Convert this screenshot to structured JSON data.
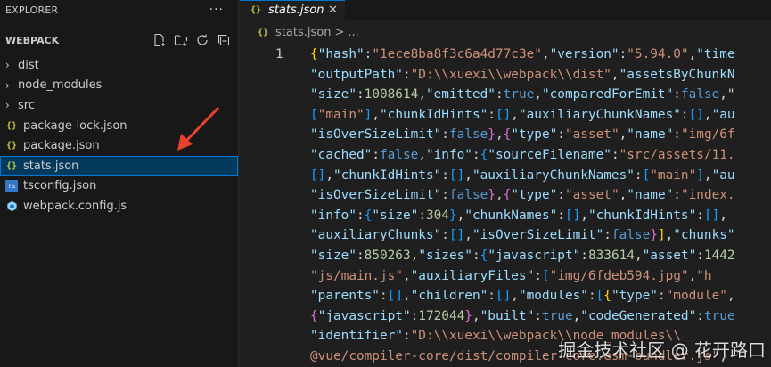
{
  "explorer": {
    "header": "EXPLORER",
    "more": "···",
    "section_title": "WEBPACK",
    "items": [
      {
        "label": "dist",
        "type": "folder"
      },
      {
        "label": "node_modules",
        "type": "folder"
      },
      {
        "label": "src",
        "type": "folder"
      },
      {
        "label": "package-lock.json",
        "type": "json"
      },
      {
        "label": "package.json",
        "type": "json"
      },
      {
        "label": "stats.json",
        "type": "json",
        "selected": true
      },
      {
        "label": "tsconfig.json",
        "type": "ts"
      },
      {
        "label": "webpack.config.js",
        "type": "webpack"
      }
    ]
  },
  "editor": {
    "tab_label": "stats.json",
    "breadcrumb": {
      "file": "stats.json",
      "separator": ">",
      "more": "..."
    },
    "line_number": "1",
    "code_lines": [
      [
        [
          "{",
          "b1"
        ],
        [
          "\"hash\"",
          "key"
        ],
        [
          ":",
          "p"
        ],
        [
          "\"1ece8ba8f3c6a4d77c3e\"",
          "str"
        ],
        [
          ",",
          "p"
        ],
        [
          "\"version\"",
          "key"
        ],
        [
          ":",
          "p"
        ],
        [
          "\"5.94.0\"",
          "str"
        ],
        [
          ",",
          "p"
        ],
        [
          "\"time",
          "key"
        ]
      ],
      [
        [
          "\"outputPath\"",
          "key"
        ],
        [
          ":",
          "p"
        ],
        [
          "\"D:\\\\xuexi\\\\webpack\\\\dist\"",
          "str"
        ],
        [
          ",",
          "p"
        ],
        [
          "\"assetsByChunkN",
          "key"
        ]
      ],
      [
        [
          "\"size\"",
          "key"
        ],
        [
          ":",
          "p"
        ],
        [
          "1008614",
          "num"
        ],
        [
          ",",
          "p"
        ],
        [
          "\"emitted\"",
          "key"
        ],
        [
          ":",
          "p"
        ],
        [
          "true",
          "kw"
        ],
        [
          ",",
          "p"
        ],
        [
          "\"comparedForEmit\"",
          "key"
        ],
        [
          ":",
          "p"
        ],
        [
          "false",
          "kw"
        ],
        [
          ",\"",
          "p"
        ]
      ],
      [
        [
          "[",
          "b3"
        ],
        [
          "\"main\"",
          "str"
        ],
        [
          "]",
          "b3"
        ],
        [
          ",",
          "p"
        ],
        [
          "\"chunkIdHints\"",
          "key"
        ],
        [
          ":",
          "p"
        ],
        [
          "[]",
          "b3"
        ],
        [
          ",",
          "p"
        ],
        [
          "\"auxiliaryChunkNames\"",
          "key"
        ],
        [
          ":",
          "p"
        ],
        [
          "[]",
          "b3"
        ],
        [
          ",",
          "p"
        ],
        [
          "\"au",
          "key"
        ]
      ],
      [
        [
          "\"isOverSizeLimit\"",
          "key"
        ],
        [
          ":",
          "p"
        ],
        [
          "false",
          "kw"
        ],
        [
          "}",
          "b2"
        ],
        [
          ",",
          "p"
        ],
        [
          "{",
          "b2"
        ],
        [
          "\"type\"",
          "key"
        ],
        [
          ":",
          "p"
        ],
        [
          "\"asset\"",
          "str"
        ],
        [
          ",",
          "p"
        ],
        [
          "\"name\"",
          "key"
        ],
        [
          ":",
          "p"
        ],
        [
          "\"img/6f",
          "str"
        ]
      ],
      [
        [
          "\"cached\"",
          "key"
        ],
        [
          ":",
          "p"
        ],
        [
          "false",
          "kw"
        ],
        [
          ",",
          "p"
        ],
        [
          "\"info\"",
          "key"
        ],
        [
          ":",
          "p"
        ],
        [
          "{",
          "b3"
        ],
        [
          "\"sourceFilename\"",
          "key"
        ],
        [
          ":",
          "p"
        ],
        [
          "\"src/assets/11.",
          "str"
        ]
      ],
      [
        [
          "[]",
          "b3"
        ],
        [
          ",",
          "p"
        ],
        [
          "\"chunkIdHints\"",
          "key"
        ],
        [
          ":",
          "p"
        ],
        [
          "[]",
          "b3"
        ],
        [
          ",",
          "p"
        ],
        [
          "\"auxiliaryChunkNames\"",
          "key"
        ],
        [
          ":",
          "p"
        ],
        [
          "[",
          "b3"
        ],
        [
          "\"main\"",
          "str"
        ],
        [
          "]",
          "b3"
        ],
        [
          ",",
          "p"
        ],
        [
          "\"au",
          "key"
        ]
      ],
      [
        [
          "\"isOverSizeLimit\"",
          "key"
        ],
        [
          ":",
          "p"
        ],
        [
          "false",
          "kw"
        ],
        [
          "}",
          "b2"
        ],
        [
          ",",
          "p"
        ],
        [
          "{",
          "b2"
        ],
        [
          "\"type\"",
          "key"
        ],
        [
          ":",
          "p"
        ],
        [
          "\"asset\"",
          "str"
        ],
        [
          ",",
          "p"
        ],
        [
          "\"name\"",
          "key"
        ],
        [
          ":",
          "p"
        ],
        [
          "\"index.",
          "str"
        ]
      ],
      [
        [
          "\"info\"",
          "key"
        ],
        [
          ":",
          "p"
        ],
        [
          "{",
          "b3"
        ],
        [
          "\"size\"",
          "key"
        ],
        [
          ":",
          "p"
        ],
        [
          "304",
          "num"
        ],
        [
          "}",
          "b3"
        ],
        [
          ",",
          "p"
        ],
        [
          "\"chunkNames\"",
          "key"
        ],
        [
          ":",
          "p"
        ],
        [
          "[]",
          "b3"
        ],
        [
          ",",
          "p"
        ],
        [
          "\"chunkIdHints\"",
          "key"
        ],
        [
          ":",
          "p"
        ],
        [
          "[]",
          "b3"
        ],
        [
          ",",
          "p"
        ]
      ],
      [
        [
          "\"auxiliaryChunks\"",
          "key"
        ],
        [
          ":",
          "p"
        ],
        [
          "[]",
          "b3"
        ],
        [
          ",",
          "p"
        ],
        [
          "\"isOverSizeLimit\"",
          "key"
        ],
        [
          ":",
          "p"
        ],
        [
          "false",
          "kw"
        ],
        [
          "}",
          "b2"
        ],
        [
          "]",
          "b1"
        ],
        [
          ",",
          "p"
        ],
        [
          "\"chunks\"",
          "key"
        ]
      ],
      [
        [
          "\"size\"",
          "key"
        ],
        [
          ":",
          "p"
        ],
        [
          "850263",
          "num"
        ],
        [
          ",",
          "p"
        ],
        [
          "\"sizes\"",
          "key"
        ],
        [
          ":",
          "p"
        ],
        [
          "{",
          "b3"
        ],
        [
          "\"javascript\"",
          "key"
        ],
        [
          ":",
          "p"
        ],
        [
          "833614",
          "num"
        ],
        [
          ",",
          "p"
        ],
        [
          "\"asset\"",
          "key"
        ],
        [
          ":",
          "p"
        ],
        [
          "1442",
          "num"
        ]
      ],
      [
        [
          "\"js/main.js\"",
          "str"
        ],
        [
          ",",
          "p"
        ],
        [
          "\"auxiliaryFiles\"",
          "key"
        ],
        [
          ":",
          "p"
        ],
        [
          "[",
          "b3"
        ],
        [
          "\"img/6fdeb594.jpg\"",
          "str"
        ],
        [
          ",",
          "p"
        ],
        [
          "\"h",
          "str"
        ]
      ],
      [
        [
          "\"parents\"",
          "key"
        ],
        [
          ":",
          "p"
        ],
        [
          "[]",
          "b3"
        ],
        [
          ",",
          "p"
        ],
        [
          "\"children\"",
          "key"
        ],
        [
          ":",
          "p"
        ],
        [
          "[]",
          "b3"
        ],
        [
          ",",
          "p"
        ],
        [
          "\"modules\"",
          "key"
        ],
        [
          ":",
          "p"
        ],
        [
          "[",
          "b3"
        ],
        [
          "{",
          "b1"
        ],
        [
          "\"type\"",
          "key"
        ],
        [
          ":",
          "p"
        ],
        [
          "\"module\"",
          "str"
        ],
        [
          ",",
          "p"
        ]
      ],
      [
        [
          "{",
          "b2"
        ],
        [
          "\"javascript\"",
          "key"
        ],
        [
          ":",
          "p"
        ],
        [
          "172044",
          "num"
        ],
        [
          "}",
          "b2"
        ],
        [
          ",",
          "p"
        ],
        [
          "\"built\"",
          "key"
        ],
        [
          ":",
          "p"
        ],
        [
          "true",
          "kw"
        ],
        [
          ",",
          "p"
        ],
        [
          "\"codeGenerated\"",
          "key"
        ],
        [
          ":",
          "p"
        ],
        [
          "true",
          "kw"
        ]
      ],
      [
        [
          "\"identifier\"",
          "key"
        ],
        [
          ":",
          "p"
        ],
        [
          "\"D:\\\\xuexi\\\\webpack\\\\node_modules\\\\",
          "str"
        ]
      ],
      [
        [
          "@vue/compiler-core/dist/compiler-core.esm-bundler.js\"",
          "str"
        ],
        [
          ",",
          "p"
        ]
      ]
    ]
  },
  "watermark": "掘金技术社区 @ 花开路口",
  "colors": {
    "selection": "#04395e",
    "selection_border": "#0078d4",
    "arrow": "#e8412c",
    "json_icon": "#cbcb41",
    "key": "#9cdcfe",
    "string": "#ce9178",
    "number": "#b5cea8",
    "keyword": "#569cd6"
  }
}
